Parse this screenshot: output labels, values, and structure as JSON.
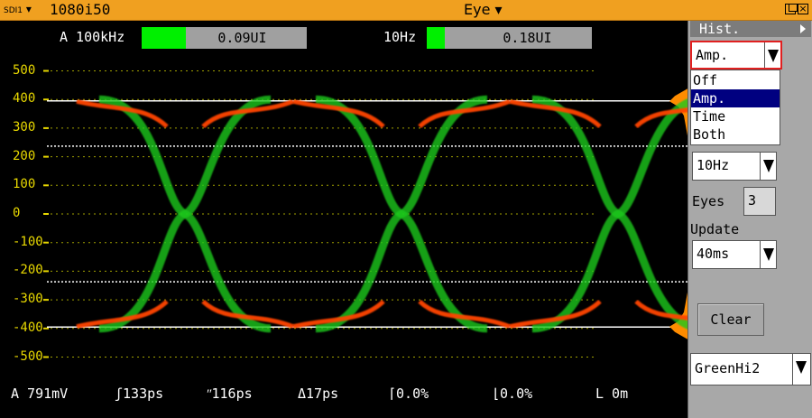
{
  "titlebar": {
    "input": "SDI1",
    "format": "1080i50",
    "title": "Eye"
  },
  "jitter": {
    "a_label": "A 100kHz",
    "a_value": "0.09UI",
    "a_level": 0.27,
    "b_label": "10Hz",
    "b_value": "0.18UI",
    "b_level": 0.11
  },
  "axis": {
    "y_ticks": [
      "500",
      "400",
      "300",
      "200",
      "100",
      "0",
      "-100",
      "-200",
      "-300",
      "-400",
      "-500"
    ],
    "ylim": [
      -550,
      550
    ]
  },
  "measurements": {
    "amplitude": "A 791mV",
    "rise_time": "ʃ133ps",
    "fall_time": "ʺ116ps",
    "delta": "Δ17ps",
    "rise_overshoot": "⌈0.0%",
    "fall_overshoot": "⌊0.0%",
    "level": "L 0m"
  },
  "panel": {
    "title": "Hist.",
    "hist_mode": "Amp.",
    "hist_options": [
      "Off",
      "Amp.",
      "Time",
      "Both"
    ],
    "hist_selected_index": 1,
    "frequency": "10Hz",
    "eyes_label": "Eyes",
    "eyes_value": "3",
    "update_label": "Update",
    "update_value": "40ms",
    "clear_label": "Clear",
    "palette": "GreenHi2"
  },
  "colors": {
    "trace": "#1ec81e",
    "trace_core": "#ff4400",
    "histogram": "#ff8c00",
    "axis_labels": "#e8d800",
    "titlebar": "#f0a020"
  }
}
